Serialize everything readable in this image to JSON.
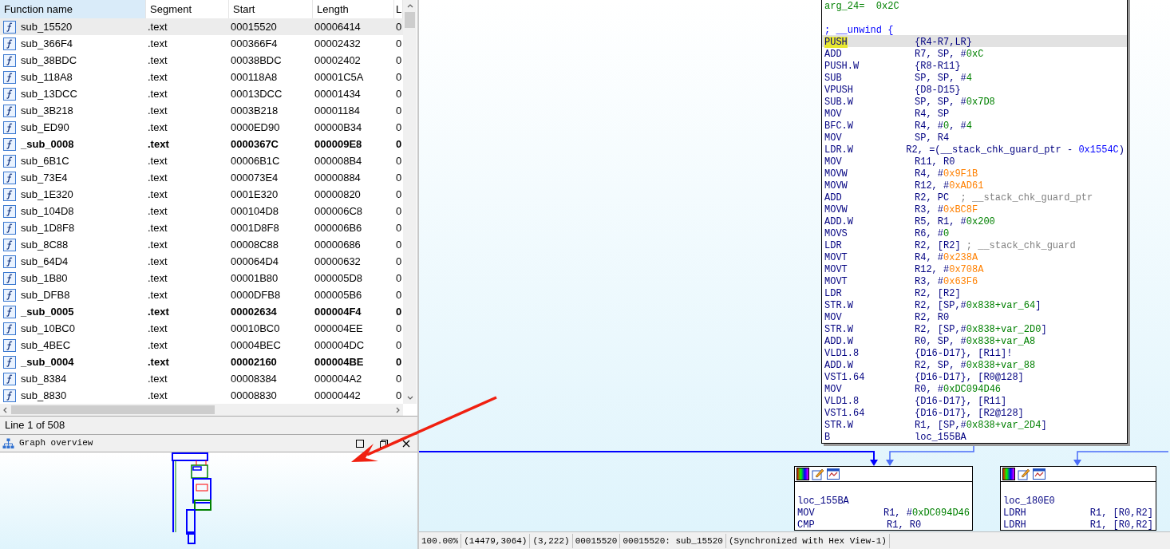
{
  "function_table": {
    "columns": [
      "Function name",
      "Segment",
      "Start",
      "Length",
      "L"
    ],
    "rows": [
      {
        "name": "sub_15520",
        "segment": ".text",
        "start": "00015520",
        "length": "00006414",
        "column_5": "0",
        "selected": true,
        "bold": false
      },
      {
        "name": "sub_366F4",
        "segment": ".text",
        "start": "000366F4",
        "length": "00002432",
        "column_5": "0",
        "selected": false,
        "bold": false
      },
      {
        "name": "sub_38BDC",
        "segment": ".text",
        "start": "00038BDC",
        "length": "00002402",
        "column_5": "0",
        "selected": false,
        "bold": false
      },
      {
        "name": "sub_118A8",
        "segment": ".text",
        "start": "000118A8",
        "length": "00001C5A",
        "column_5": "0",
        "selected": false,
        "bold": false
      },
      {
        "name": "sub_13DCC",
        "segment": ".text",
        "start": "00013DCC",
        "length": "00001434",
        "column_5": "0",
        "selected": false,
        "bold": false
      },
      {
        "name": "sub_3B218",
        "segment": ".text",
        "start": "0003B218",
        "length": "00001184",
        "column_5": "0",
        "selected": false,
        "bold": false
      },
      {
        "name": "sub_ED90",
        "segment": ".text",
        "start": "0000ED90",
        "length": "00000B34",
        "column_5": "0",
        "selected": false,
        "bold": false
      },
      {
        "name": "_sub_0008",
        "segment": ".text",
        "start": "0000367C",
        "length": "000009E8",
        "column_5": "0",
        "selected": false,
        "bold": true
      },
      {
        "name": "sub_6B1C",
        "segment": ".text",
        "start": "00006B1C",
        "length": "000008B4",
        "column_5": "0",
        "selected": false,
        "bold": false
      },
      {
        "name": "sub_73E4",
        "segment": ".text",
        "start": "000073E4",
        "length": "00000884",
        "column_5": "0",
        "selected": false,
        "bold": false
      },
      {
        "name": "sub_1E320",
        "segment": ".text",
        "start": "0001E320",
        "length": "00000820",
        "column_5": "0",
        "selected": false,
        "bold": false
      },
      {
        "name": "sub_104D8",
        "segment": ".text",
        "start": "000104D8",
        "length": "000006C8",
        "column_5": "0",
        "selected": false,
        "bold": false
      },
      {
        "name": "sub_1D8F8",
        "segment": ".text",
        "start": "0001D8F8",
        "length": "000006B6",
        "column_5": "0",
        "selected": false,
        "bold": false
      },
      {
        "name": "sub_8C88",
        "segment": ".text",
        "start": "00008C88",
        "length": "00000686",
        "column_5": "0",
        "selected": false,
        "bold": false
      },
      {
        "name": "sub_64D4",
        "segment": ".text",
        "start": "000064D4",
        "length": "00000632",
        "column_5": "0",
        "selected": false,
        "bold": false
      },
      {
        "name": "sub_1B80",
        "segment": ".text",
        "start": "00001B80",
        "length": "000005D8",
        "column_5": "0",
        "selected": false,
        "bold": false
      },
      {
        "name": "sub_DFB8",
        "segment": ".text",
        "start": "0000DFB8",
        "length": "000005B6",
        "column_5": "0",
        "selected": false,
        "bold": false
      },
      {
        "name": "_sub_0005",
        "segment": ".text",
        "start": "00002634",
        "length": "000004F4",
        "column_5": "0",
        "selected": false,
        "bold": true
      },
      {
        "name": "sub_10BC0",
        "segment": ".text",
        "start": "00010BC0",
        "length": "000004EE",
        "column_5": "0",
        "selected": false,
        "bold": false
      },
      {
        "name": "sub_4BEC",
        "segment": ".text",
        "start": "00004BEC",
        "length": "000004DC",
        "column_5": "0",
        "selected": false,
        "bold": false
      },
      {
        "name": "_sub_0004",
        "segment": ".text",
        "start": "00002160",
        "length": "000004BE",
        "column_5": "0",
        "selected": false,
        "bold": true
      },
      {
        "name": "sub_8384",
        "segment": ".text",
        "start": "00008384",
        "length": "000004A2",
        "column_5": "0",
        "selected": false,
        "bold": false
      },
      {
        "name": "sub_8830",
        "segment": ".text",
        "start": "00008830",
        "length": "00000442",
        "column_5": "0",
        "selected": false,
        "bold": false
      }
    ]
  },
  "status_line": "Line 1 of 508",
  "graph_overview": {
    "title": "Graph overview"
  },
  "graph": {
    "main_block": {
      "lines": [
        {
          "kind": "var",
          "text": "arg_24=  0x2C"
        },
        {
          "kind": "comment",
          "text": "; __unwind {"
        },
        {
          "kind": "insn",
          "selected": true,
          "mnemonic": "PUSH",
          "operands": [
            {
              "t": "{R4-R7,LR}",
              "kind": "reg"
            }
          ]
        },
        {
          "kind": "insn",
          "selected": false,
          "mnemonic": "ADD",
          "operands": [
            {
              "t": "R7, SP, #",
              "kind": "reg"
            },
            {
              "t": "0xC",
              "kind": "imm"
            }
          ]
        },
        {
          "kind": "insn",
          "selected": false,
          "mnemonic": "PUSH.W",
          "operands": [
            {
              "t": "{R8-R11}",
              "kind": "reg"
            }
          ]
        },
        {
          "kind": "insn",
          "selected": false,
          "mnemonic": "SUB",
          "operands": [
            {
              "t": "SP, SP, #",
              "kind": "reg"
            },
            {
              "t": "4",
              "kind": "imm"
            }
          ]
        },
        {
          "kind": "insn",
          "selected": false,
          "mnemonic": "VPUSH",
          "operands": [
            {
              "t": "{D8-D15}",
              "kind": "reg"
            }
          ]
        },
        {
          "kind": "insn",
          "selected": false,
          "mnemonic": "SUB.W",
          "operands": [
            {
              "t": "SP, SP, #",
              "kind": "reg"
            },
            {
              "t": "0x7D8",
              "kind": "imm"
            }
          ]
        },
        {
          "kind": "insn",
          "selected": false,
          "mnemonic": "MOV",
          "operands": [
            {
              "t": "R4, SP",
              "kind": "reg"
            }
          ]
        },
        {
          "kind": "insn",
          "selected": false,
          "mnemonic": "BFC.W",
          "operands": [
            {
              "t": "R4, #",
              "kind": "reg"
            },
            {
              "t": "0",
              "kind": "imm"
            },
            {
              "t": ", #",
              "kind": "reg"
            },
            {
              "t": "4",
              "kind": "imm"
            }
          ]
        },
        {
          "kind": "insn",
          "selected": false,
          "mnemonic": "MOV",
          "operands": [
            {
              "t": "SP, R4",
              "kind": "reg"
            }
          ]
        },
        {
          "kind": "insn",
          "selected": false,
          "mnemonic": "LDR.W",
          "operands": [
            {
              "t": "R2, =(__stack_chk_guard_ptr - ",
              "kind": "reg"
            },
            {
              "t": "0x1554C",
              "kind": "addr"
            },
            {
              "t": ")",
              "kind": "reg"
            }
          ]
        },
        {
          "kind": "insn",
          "selected": false,
          "mnemonic": "MOV",
          "operands": [
            {
              "t": "R11, R0",
              "kind": "reg"
            }
          ]
        },
        {
          "kind": "insn",
          "selected": false,
          "mnemonic": "MOVW",
          "operands": [
            {
              "t": "R4, #",
              "kind": "reg"
            },
            {
              "t": "0x9F1B",
              "kind": "const"
            }
          ]
        },
        {
          "kind": "insn",
          "selected": false,
          "mnemonic": "MOVW",
          "operands": [
            {
              "t": "R12, #",
              "kind": "reg"
            },
            {
              "t": "0xAD61",
              "kind": "const"
            }
          ]
        },
        {
          "kind": "insn",
          "selected": false,
          "mnemonic": "ADD",
          "operands": [
            {
              "t": "R2, PC",
              "kind": "reg"
            },
            {
              "t": "  ; __stack_chk_guard_ptr",
              "kind": "cmt"
            }
          ]
        },
        {
          "kind": "insn",
          "selected": false,
          "mnemonic": "MOVW",
          "operands": [
            {
              "t": "R3, #",
              "kind": "reg"
            },
            {
              "t": "0xBC8F",
              "kind": "const"
            }
          ]
        },
        {
          "kind": "insn",
          "selected": false,
          "mnemonic": "ADD.W",
          "operands": [
            {
              "t": "R5, R1, #",
              "kind": "reg"
            },
            {
              "t": "0x200",
              "kind": "imm"
            }
          ]
        },
        {
          "kind": "insn",
          "selected": false,
          "mnemonic": "MOVS",
          "operands": [
            {
              "t": "R6, #",
              "kind": "reg"
            },
            {
              "t": "0",
              "kind": "imm"
            }
          ]
        },
        {
          "kind": "insn",
          "selected": false,
          "mnemonic": "LDR",
          "operands": [
            {
              "t": "R2, [R2]",
              "kind": "reg"
            },
            {
              "t": " ; __stack_chk_guard",
              "kind": "cmt"
            }
          ]
        },
        {
          "kind": "insn",
          "selected": false,
          "mnemonic": "MOVT",
          "operands": [
            {
              "t": "R4, #",
              "kind": "reg"
            },
            {
              "t": "0x238A",
              "kind": "const"
            }
          ]
        },
        {
          "kind": "insn",
          "selected": false,
          "mnemonic": "MOVT",
          "operands": [
            {
              "t": "R12, #",
              "kind": "reg"
            },
            {
              "t": "0x708A",
              "kind": "const"
            }
          ]
        },
        {
          "kind": "insn",
          "selected": false,
          "mnemonic": "MOVT",
          "operands": [
            {
              "t": "R3, #",
              "kind": "reg"
            },
            {
              "t": "0x63F6",
              "kind": "const"
            }
          ]
        },
        {
          "kind": "insn",
          "selected": false,
          "mnemonic": "LDR",
          "operands": [
            {
              "t": "R2, [R2]",
              "kind": "reg"
            }
          ]
        },
        {
          "kind": "insn",
          "selected": false,
          "mnemonic": "STR.W",
          "operands": [
            {
              "t": "R2, [SP,#",
              "kind": "reg"
            },
            {
              "t": "0x838+var_64",
              "kind": "imm"
            },
            {
              "t": "]",
              "kind": "reg"
            }
          ]
        },
        {
          "kind": "insn",
          "selected": false,
          "mnemonic": "MOV",
          "operands": [
            {
              "t": "R2, R0",
              "kind": "reg"
            }
          ]
        },
        {
          "kind": "insn",
          "selected": false,
          "mnemonic": "STR.W",
          "operands": [
            {
              "t": "R2, [SP,#",
              "kind": "reg"
            },
            {
              "t": "0x838+var_2D0",
              "kind": "imm"
            },
            {
              "t": "]",
              "kind": "reg"
            }
          ]
        },
        {
          "kind": "insn",
          "selected": false,
          "mnemonic": "ADD.W",
          "operands": [
            {
              "t": "R0, SP, #",
              "kind": "reg"
            },
            {
              "t": "0x838+var_A8",
              "kind": "imm"
            }
          ]
        },
        {
          "kind": "insn",
          "selected": false,
          "mnemonic": "VLD1.8",
          "operands": [
            {
              "t": "{D16-D17}, [R11]!",
              "kind": "reg"
            }
          ]
        },
        {
          "kind": "insn",
          "selected": false,
          "mnemonic": "ADD.W",
          "operands": [
            {
              "t": "R2, SP, #",
              "kind": "reg"
            },
            {
              "t": "0x838+var_88",
              "kind": "imm"
            }
          ]
        },
        {
          "kind": "insn",
          "selected": false,
          "mnemonic": "VST1.64",
          "operands": [
            {
              "t": "{D16-D17}, [R0@128]",
              "kind": "reg"
            }
          ]
        },
        {
          "kind": "insn",
          "selected": false,
          "mnemonic": "MOV",
          "operands": [
            {
              "t": "R0, #",
              "kind": "reg"
            },
            {
              "t": "0xDC094D46",
              "kind": "imm"
            }
          ]
        },
        {
          "kind": "insn",
          "selected": false,
          "mnemonic": "VLD1.8",
          "operands": [
            {
              "t": "{D16-D17}, [R11]",
              "kind": "reg"
            }
          ]
        },
        {
          "kind": "insn",
          "selected": false,
          "mnemonic": "VST1.64",
          "operands": [
            {
              "t": "{D16-D17}, [R2@128]",
              "kind": "reg"
            }
          ]
        },
        {
          "kind": "insn",
          "selected": false,
          "mnemonic": "STR.W",
          "operands": [
            {
              "t": "R1, [SP,#",
              "kind": "reg"
            },
            {
              "t": "0x838+var_2D4",
              "kind": "imm"
            },
            {
              "t": "]",
              "kind": "reg"
            }
          ]
        },
        {
          "kind": "insn",
          "selected": false,
          "mnemonic": "B",
          "operands": [
            {
              "t": "loc_155BA",
              "kind": "reg"
            }
          ]
        }
      ]
    },
    "blocks": [
      {
        "label": "loc_155BA",
        "lines": [
          {
            "kind": "insn",
            "selected": false,
            "mnemonic": "MOV",
            "operands": [
              {
                "t": "R1, #",
                "kind": "reg"
              },
              {
                "t": "0xDC094D46",
                "kind": "imm"
              }
            ]
          },
          {
            "kind": "insn",
            "selected": false,
            "mnemonic": "CMP",
            "operands": [
              {
                "t": "R1, R0",
                "kind": "reg"
              }
            ]
          }
        ]
      },
      {
        "label": "loc_180E0",
        "lines": [
          {
            "kind": "insn",
            "selected": false,
            "mnemonic": "LDRH",
            "operands": [
              {
                "t": "R1, [R0,R2]",
                "kind": "reg"
              }
            ]
          },
          {
            "kind": "insn",
            "selected": false,
            "mnemonic": "LDRH",
            "operands": [
              {
                "t": "R1, [R0,R2]",
                "kind": "reg"
              }
            ]
          }
        ]
      }
    ]
  },
  "status_bar": [
    "100.00%",
    "(14479,3064)",
    "(3,222)",
    "00015520",
    "00015520: sub_15520",
    "(Synchronized with Hex View-1)"
  ]
}
